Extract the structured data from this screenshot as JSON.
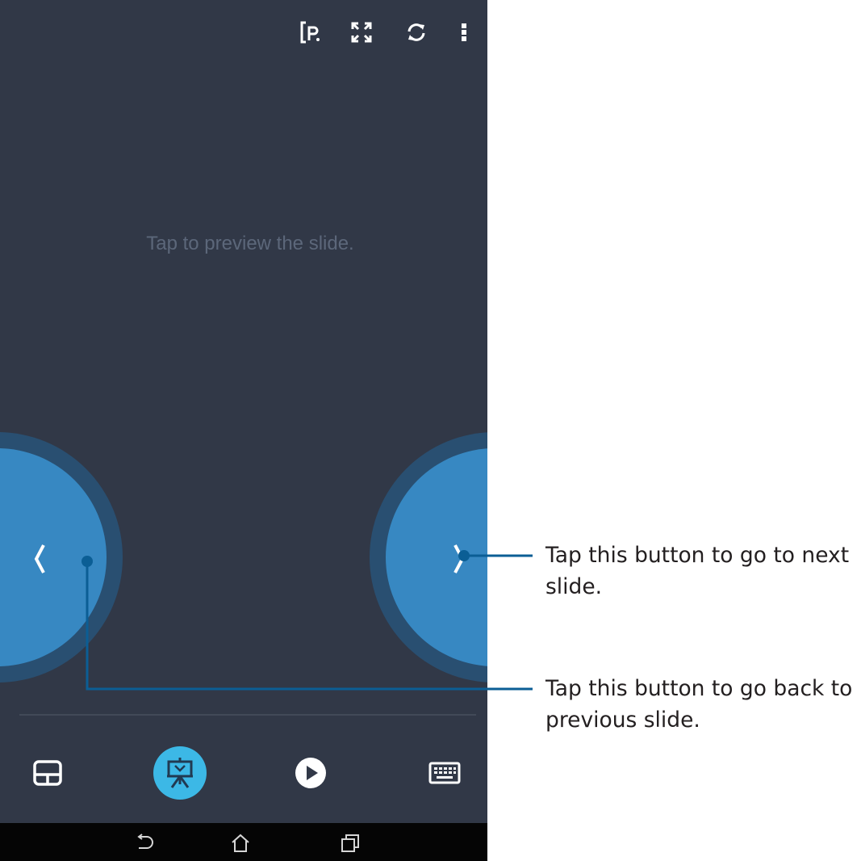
{
  "app": {
    "hint_text": "Tap to preview the slide."
  },
  "toolbar": {
    "icons": [
      "presentation-file-icon",
      "fullscreen-icon",
      "sync-icon",
      "more-vert-icon"
    ]
  },
  "navigation": {
    "previous_glyph": "‹",
    "next_glyph": "›"
  },
  "bottom_bar": {
    "items": [
      {
        "icon": "touchpad-icon",
        "active": false
      },
      {
        "icon": "presentation-icon",
        "active": true
      },
      {
        "icon": "play-icon",
        "active": false
      },
      {
        "icon": "keyboard-icon",
        "active": false
      }
    ]
  },
  "system_nav": {
    "icons": [
      "back-icon",
      "home-icon",
      "recent-apps-icon"
    ]
  },
  "callouts": {
    "next_line1": "Tap this button to go to next",
    "next_line2": "slide.",
    "prev_line1": "Tap this button to go back to",
    "prev_line2": "previous slide."
  },
  "colors": {
    "background": "#313847",
    "nav_button": "#3788c2",
    "nav_ring": "#294f71",
    "active_mode": "#3cb8e6",
    "callout_line": "#0b5e95"
  }
}
